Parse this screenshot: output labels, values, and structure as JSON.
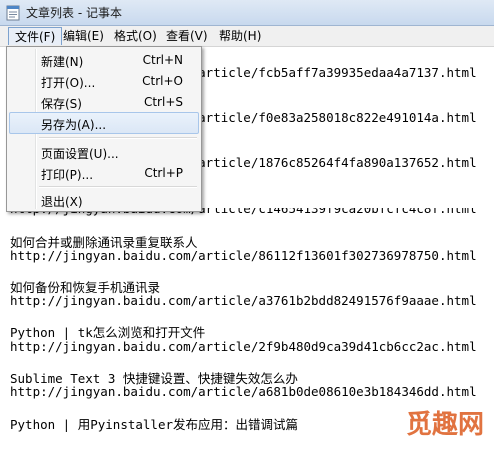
{
  "window": {
    "title": "文章列表 - 记事本"
  },
  "menubar": [
    {
      "label": "文件(F)",
      "open": true
    },
    {
      "label": "编辑(E)"
    },
    {
      "label": "格式(O)"
    },
    {
      "label": "查看(V)"
    },
    {
      "label": "帮助(H)"
    }
  ],
  "file_menu": {
    "items": [
      {
        "label": "新建(N)",
        "accel": "Ctrl+N"
      },
      {
        "label": "打开(O)...",
        "accel": "Ctrl+O"
      },
      {
        "label": "保存(S)",
        "accel": "Ctrl+S"
      },
      {
        "label": "另存为(A)...",
        "accel": "",
        "highlighted": true
      },
      {
        "label": "页面设置(U)...",
        "accel": ""
      },
      {
        "label": "打印(P)...",
        "accel": "Ctrl+P"
      },
      {
        "label": "退出(X)",
        "accel": ""
      }
    ]
  },
  "content": {
    "lines": [
      "http://jingyan.baidu.com/article/fcb5aff7a39935edaa4a7137.html",
      "http://jingyan.baidu.com/article/f0e83a258018c822e491014a.html",
      "http://jingyan.baidu.com/article/1876c85264f4fa890a137652.html",
      "http://jingyan.baidu.com/article/c14654139f9ca20bfcfc4c8f.html",
      "如何合并或删除通讯录重复联系人",
      "http://jingyan.baidu.com/article/86112f13601f302736978750.html",
      "如何备份和恢复手机通讯录",
      "http://jingyan.baidu.com/article/a3761b2bdd82491576f9aaae.html",
      "Python | tk怎么浏览和打开文件",
      "http://jingyan.baidu.com/article/2f9b480d9ca39d41cb6cc2ac.html",
      "Sublime Text 3 快捷键设置、快捷键失效怎么办",
      "http://jingyan.baidu.com/article/a681b0de08610e3b184346dd.html",
      "Python | 用Pyinstaller发布应用：出错调试篇"
    ]
  },
  "watermark": {
    "text": "觅趣网"
  },
  "colors": {
    "menu_highlight": "#dbe7f6",
    "title_bar": "#c8d9ee"
  }
}
